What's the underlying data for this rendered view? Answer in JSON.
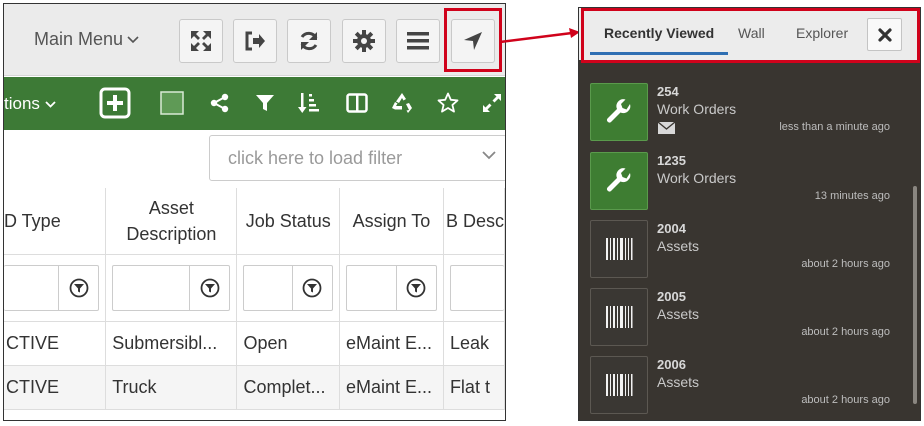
{
  "toolbar": {
    "main_menu_label": "Main Menu",
    "buttons": [
      {
        "name": "fullscreen",
        "icon": "expand-icon"
      },
      {
        "name": "logout",
        "icon": "sign-out-icon"
      },
      {
        "name": "refresh",
        "icon": "refresh-icon"
      },
      {
        "name": "settings",
        "icon": "gear-icon"
      },
      {
        "name": "menu",
        "icon": "hamburger-icon"
      },
      {
        "name": "navigator",
        "icon": "location-arrow-icon"
      }
    ]
  },
  "actionbar": {
    "actions_label": "tions",
    "icons": [
      "plus-square-icon",
      "square-icon",
      "share-icon",
      "filter-icon",
      "sort-amount-icon",
      "columns-icon",
      "recycle-icon",
      "star-icon",
      "expand-arrows-icon"
    ]
  },
  "filter": {
    "placeholder": "click here to load filter"
  },
  "grid": {
    "columns": [
      {
        "label": "D Type"
      },
      {
        "label": "Asset Description"
      },
      {
        "label": "Job Status"
      },
      {
        "label": "Assign To"
      },
      {
        "label": "B Desc"
      }
    ],
    "rows": [
      [
        "CTIVE",
        "Submersibl...",
        "Open",
        "eMaint E...",
        "Leak"
      ],
      [
        "CTIVE",
        "Truck",
        "Complet...",
        "eMaint E...",
        "Flat t"
      ]
    ]
  },
  "panel": {
    "tabs": [
      {
        "label": "Recently Viewed",
        "active": true
      },
      {
        "label": "Wall",
        "active": false
      },
      {
        "label": "Explorer",
        "active": false
      }
    ],
    "close_icon": "close-icon",
    "items": [
      {
        "number": "254",
        "type": "Work Orders",
        "time": "less than a minute ago",
        "kind": "wrench-icon",
        "mail": true
      },
      {
        "number": "1235",
        "type": "Work Orders",
        "time": "13 minutes ago",
        "kind": "wrench-icon",
        "mail": false
      },
      {
        "number": "2004",
        "type": "Assets",
        "time": "about 2 hours ago",
        "kind": "barcode-icon",
        "mail": false
      },
      {
        "number": "2005",
        "type": "Assets",
        "time": "about 2 hours ago",
        "kind": "barcode-icon",
        "mail": false
      },
      {
        "number": "2006",
        "type": "Assets",
        "time": "about 2 hours ago",
        "kind": "barcode-icon",
        "mail": false
      }
    ]
  },
  "colors": {
    "highlight": "#d0021b",
    "green_bar": "#3d7a36",
    "panel_bg": "#393530",
    "wo_tile": "#3e7d32",
    "tab_underline": "#2f6fb3"
  }
}
